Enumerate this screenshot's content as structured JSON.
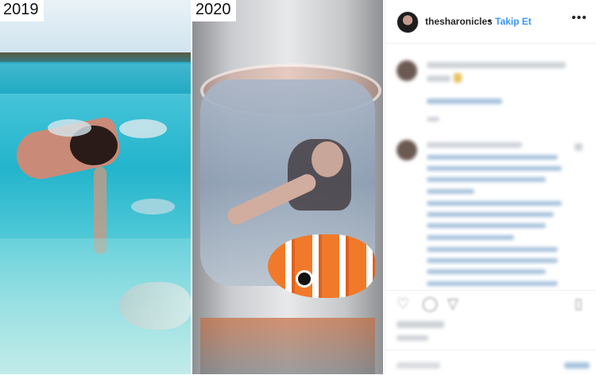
{
  "photos": {
    "left_year": "2019",
    "right_year": "2020"
  },
  "header": {
    "username": "thesharonicles",
    "separator": "•",
    "follow_label": "Takip Et",
    "more_icon": "more-options-icon",
    "more_glyph": "•••"
  },
  "actions": {
    "like_icon": "heart-icon",
    "comment_icon": "comment-icon",
    "share_icon": "share-icon",
    "save_icon": "bookmark-icon"
  },
  "colors": {
    "accent": "#3897f0",
    "text": "#262626"
  }
}
